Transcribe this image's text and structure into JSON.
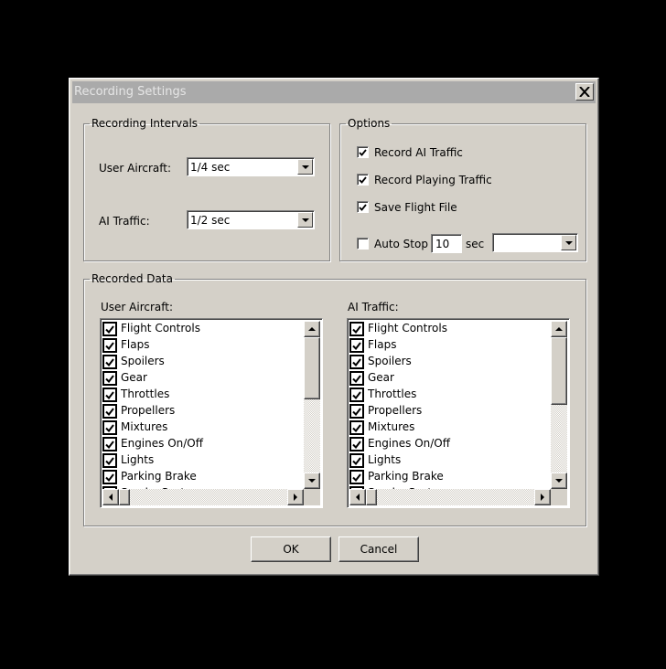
{
  "window": {
    "title": "Recording Settings",
    "close_icon": "close-icon"
  },
  "recording_intervals": {
    "legend": "Recording Intervals",
    "user_aircraft_label": "User Aircraft:",
    "user_aircraft_value": "1/4 sec",
    "ai_traffic_label": "AI Traffic:",
    "ai_traffic_value": "1/2 sec"
  },
  "options": {
    "legend": "Options",
    "items": [
      {
        "label": "Record AI Traffic",
        "checked": true
      },
      {
        "label": "Record Playing Traffic",
        "checked": true
      },
      {
        "label": "Save Flight File",
        "checked": true
      }
    ],
    "auto_stop": {
      "label": "Auto Stop",
      "checked": false,
      "value": "10",
      "unit": "sec",
      "dropdown_value": ""
    }
  },
  "recorded_data": {
    "legend": "Recorded Data",
    "user_aircraft": {
      "label": "User Aircraft:",
      "items": [
        {
          "label": "Flight Controls",
          "checked": true
        },
        {
          "label": "Flaps",
          "checked": true
        },
        {
          "label": "Spoilers",
          "checked": true
        },
        {
          "label": "Gear",
          "checked": true
        },
        {
          "label": "Throttles",
          "checked": true
        },
        {
          "label": "Propellers",
          "checked": true
        },
        {
          "label": "Mixtures",
          "checked": true
        },
        {
          "label": "Engines On/Off",
          "checked": true
        },
        {
          "label": "Lights",
          "checked": true
        },
        {
          "label": "Parking Brake",
          "checked": true
        },
        {
          "label": "Smoke System",
          "checked": true
        }
      ]
    },
    "ai_traffic": {
      "label": "AI Traffic:",
      "items": [
        {
          "label": "Flight Controls",
          "checked": true
        },
        {
          "label": "Flaps",
          "checked": true
        },
        {
          "label": "Spoilers",
          "checked": true
        },
        {
          "label": "Gear",
          "checked": true
        },
        {
          "label": "Throttles",
          "checked": true
        },
        {
          "label": "Propellers",
          "checked": true
        },
        {
          "label": "Mixtures",
          "checked": true
        },
        {
          "label": "Engines On/Off",
          "checked": true
        },
        {
          "label": "Lights",
          "checked": true
        },
        {
          "label": "Parking Brake",
          "checked": true
        },
        {
          "label": "Smoke System",
          "checked": true
        }
      ]
    }
  },
  "buttons": {
    "ok": "OK",
    "cancel": "Cancel"
  }
}
